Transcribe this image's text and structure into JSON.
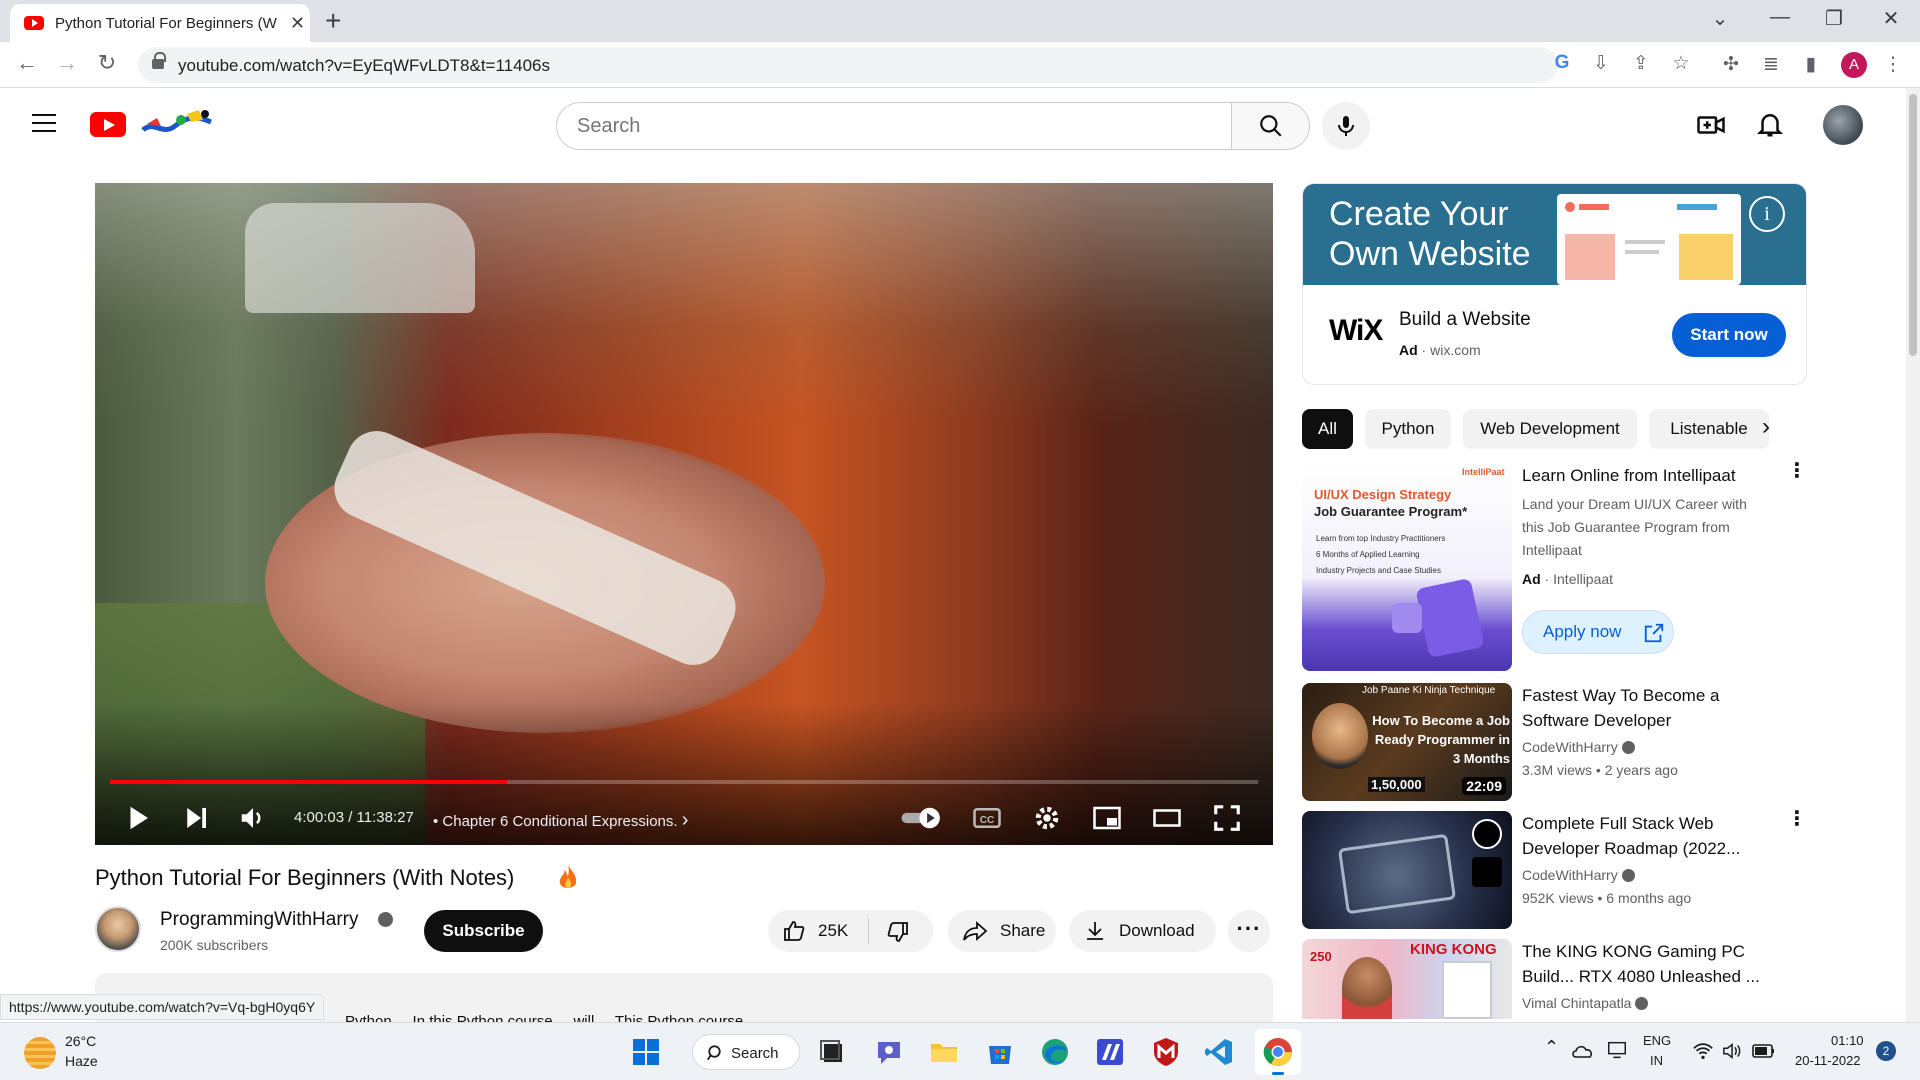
{
  "browser": {
    "tab_title": "Python Tutorial For Beginners (W",
    "tab_close": "✕",
    "new_tab": "+",
    "url": "youtube.com/watch?v=EyEqWFvLDT8&t=11406s",
    "profile_initial": "A",
    "status_url": "https://www.youtube.com/watch?v=Vq-bgH0yq6Y"
  },
  "header": {
    "search_placeholder": "Search"
  },
  "player": {
    "progress": 0.346,
    "time": "4:00:03 / 11:38:27",
    "chapter": "• Chapter 6 Conditional Expressions.",
    "chapter_arrow": "›"
  },
  "video": {
    "title": "Python Tutorial For Beginners (With Notes)",
    "channel": "ProgrammingWithHarry",
    "subscribers": "200K subscribers",
    "subscribe_label": "Subscribe",
    "likes": "25K",
    "share_label": "Share",
    "download_label": "Download",
    "more_label": "···",
    "description_snippet": "Python ... In this Python course ... will ... This Python course ..."
  },
  "ad": {
    "banner_text": "Create Your Own Website",
    "info_label": "i",
    "logo": "WiX",
    "title": "Build a Website",
    "badge": "Ad",
    "domain": "wix.com",
    "cta": "Start now"
  },
  "chips": [
    "All",
    "Python",
    "Web Development",
    "Listenable"
  ],
  "recommendations": [
    {
      "title": "Learn Online from Intellipaat",
      "description": "Land your Dream UI/UX Career with this Job Guarantee Program from Intellipaat",
      "badge": "Ad",
      "advertiser": "Intellipaat",
      "cta": "Apply now",
      "thumb_heading": "UI/UX Design Strategy",
      "thumb_sub": "Job Guarantee Program*",
      "thumb_bullets": [
        "Learn from top Industry Practitioners",
        "6 Months of Applied Learning",
        "Industry Projects and Case Studies"
      ],
      "thumb_brand": "IntelliPaat"
    },
    {
      "title": "Fastest Way To Become a Software Developer",
      "channel": "CodeWithHarry",
      "meta": "3.3M views  • 2 years ago",
      "duration": "22:09",
      "thumb_top": "Job Paane Ki Ninja Technique",
      "thumb_text": "How To Become a Job Ready Programmer in 3 Months",
      "thumb_price": "1,50,000"
    },
    {
      "title": "Complete Full Stack Web Developer Roadmap (2022...",
      "channel": "CodeWithHarry",
      "meta": "952K views  • 6 months ago"
    },
    {
      "title": "The KING KONG Gaming PC Build... RTX 4080 Unleashed ...",
      "channel": "Vimal Chintapatla",
      "thumb_text": "KING KONG",
      "thumb_num": "250"
    }
  ],
  "taskbar": {
    "temperature": "26°C",
    "condition": "Haze",
    "search_label": "Search",
    "lang1": "ENG",
    "lang2": "IN",
    "time": "01:10",
    "date": "20-11-2022",
    "notifications": "2"
  },
  "colors": {
    "yt_red": "#ff0000",
    "accent_blue": "#065fd4",
    "ad_banner": "#2b6f90"
  }
}
